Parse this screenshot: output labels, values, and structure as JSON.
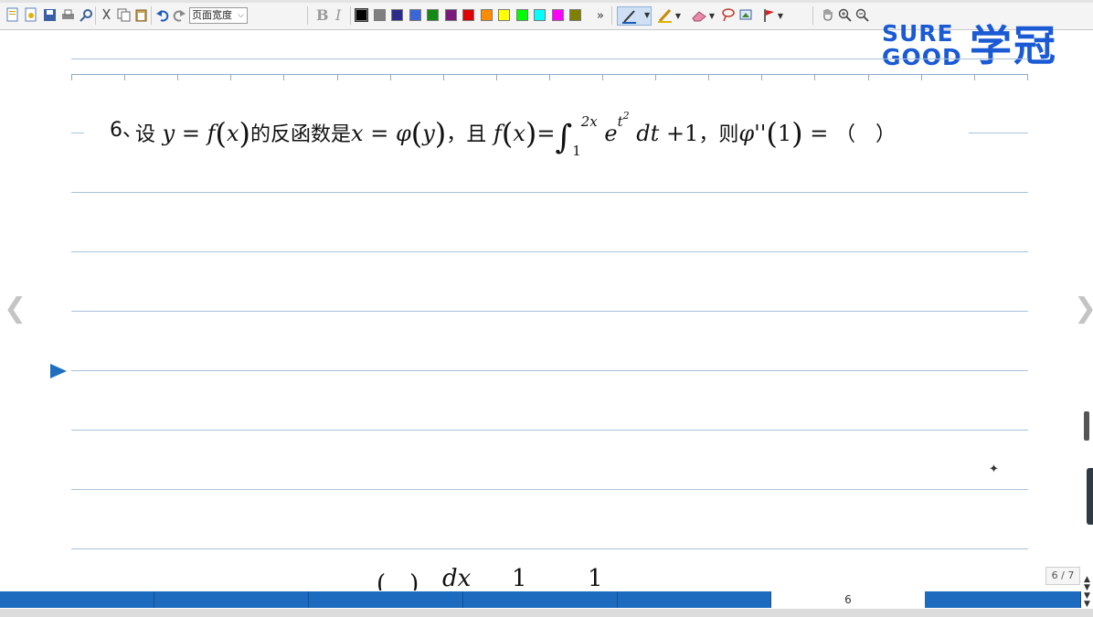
{
  "toolbar": {
    "zoom_select": "页面宽度",
    "bold_label": "B",
    "italic_label": "I",
    "overflow_label": "»",
    "colors": [
      "#000000",
      "#7f7f7f",
      "#2b2b8a",
      "#3a66d8",
      "#138a13",
      "#7a1a7a",
      "#e00000",
      "#ff8c00",
      "#ffff00",
      "#00ff00",
      "#00ffff",
      "#ff00ff",
      "#808000"
    ]
  },
  "logo": {
    "sure": "SURE",
    "good": "GOOD",
    "cn": "学冠"
  },
  "question": {
    "number": "6",
    "sep": "、",
    "t1": "设",
    "t2": "的反函数是",
    "t3": "，且",
    "t4": "，则",
    "t5": "（　）"
  },
  "bottom_math": {
    "paren": "(　)",
    "dx": "dx",
    "one_a": "1",
    "one_b": "1"
  },
  "page_indicator": "6 / 7",
  "status": {
    "page_number": "6"
  }
}
